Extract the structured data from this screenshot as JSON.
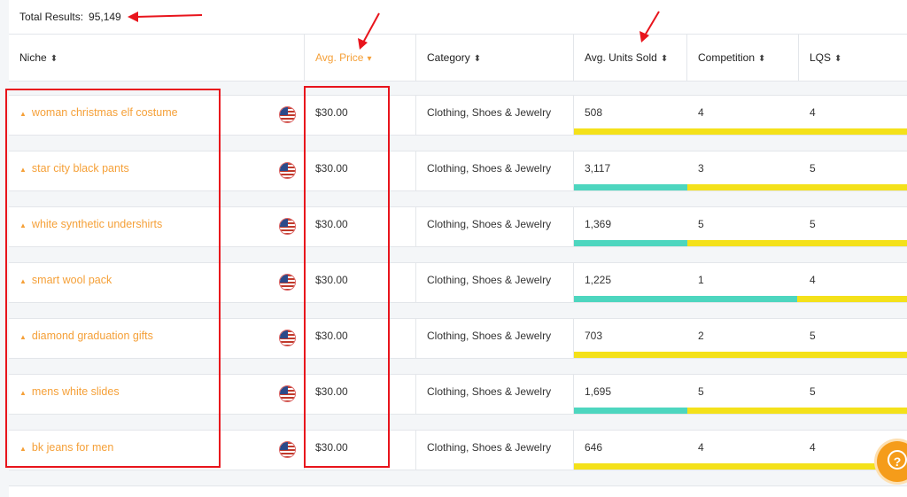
{
  "summary": {
    "label": "Total Results:",
    "count": "95,149"
  },
  "columns": [
    {
      "label": "Niche",
      "sort_icon": "sort-both-icon"
    },
    {
      "label": "Avg. Price",
      "sort_icon": "sort-down-icon",
      "active": true
    },
    {
      "label": "Category",
      "sort_icon": "sort-both-icon"
    },
    {
      "label": "Avg. Units Sold",
      "sort_icon": "sort-both-icon"
    },
    {
      "label": "Competition",
      "sort_icon": "sort-both-icon"
    },
    {
      "label": "LQS",
      "sort_icon": "sort-both-icon"
    }
  ],
  "rows": [
    {
      "niche": "woman christmas elf costume",
      "price": "$30.00",
      "category": "Clothing, Shoes & Jewelry",
      "units": "508",
      "competition": "4",
      "lqs": "4",
      "bar_fill": 0.0
    },
    {
      "niche": "star city black pants",
      "price": "$30.00",
      "category": "Clothing, Shoes & Jewelry",
      "units": "3,117",
      "competition": "3",
      "lqs": "5",
      "bar_fill": 0.34
    },
    {
      "niche": "white synthetic undershirts",
      "price": "$30.00",
      "category": "Clothing, Shoes & Jewelry",
      "units": "1,369",
      "competition": "5",
      "lqs": "5",
      "bar_fill": 0.34
    },
    {
      "niche": "smart wool pack",
      "price": "$30.00",
      "category": "Clothing, Shoes & Jewelry",
      "units": "1,225",
      "competition": "1",
      "lqs": "4",
      "bar_fill": 0.67
    },
    {
      "niche": "diamond graduation gifts",
      "price": "$30.00",
      "category": "Clothing, Shoes & Jewelry",
      "units": "703",
      "competition": "2",
      "lqs": "5",
      "bar_fill": 0.0
    },
    {
      "niche": "mens white slides",
      "price": "$30.00",
      "category": "Clothing, Shoes & Jewelry",
      "units": "1,695",
      "competition": "5",
      "lqs": "5",
      "bar_fill": 0.34
    },
    {
      "niche": "bk jeans for men",
      "price": "$30.00",
      "category": "Clothing, Shoes & Jewelry",
      "units": "646",
      "competition": "4",
      "lqs": "4",
      "bar_fill": 0.0
    }
  ],
  "colors": {
    "accent": "#f5a038",
    "bar_yellow": "#f4e11a",
    "bar_teal": "#4dd6bf",
    "annotation_red": "#e8141c",
    "help": "#f59c1a"
  },
  "help": {
    "icon": "question-icon",
    "glyph": "?"
  }
}
